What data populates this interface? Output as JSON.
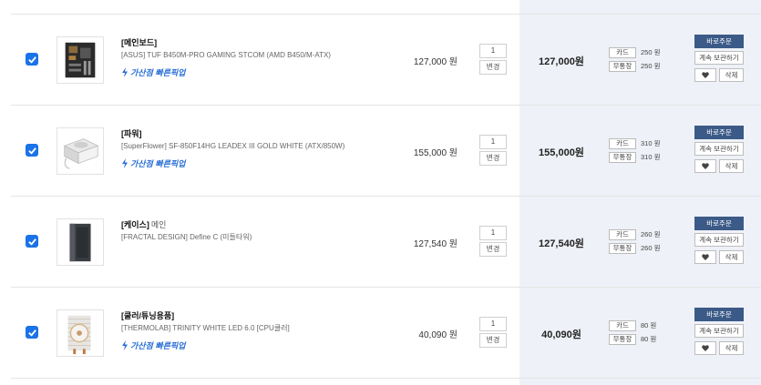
{
  "cart": {
    "items": [
      {
        "category": "[메인보드]",
        "category_sub": "",
        "name": "[ASUS] TUF B450M-PRO GAMING STCOM (AMD B450/M-ATX)",
        "pickup": "가산점 빠른픽업",
        "unit_price": "127,000 원",
        "quantity": "1",
        "change_label": "변경",
        "total": "127,000원",
        "card_label": "카드",
        "card_points": "250 원",
        "cash_label": "무통장",
        "cash_points": "250 원",
        "buy_label": "바로주문",
        "keep_label": "계속 보관하기",
        "delete_label": "삭제",
        "image": "motherboard-image"
      },
      {
        "category": "[파워]",
        "category_sub": "",
        "name": "[SuperFlower] SF-850F14HG LEADEX III GOLD WHITE (ATX/850W)",
        "pickup": "가산점 빠른픽업",
        "unit_price": "155,000 원",
        "quantity": "1",
        "change_label": "변경",
        "total": "155,000원",
        "card_label": "카드",
        "card_points": "310 원",
        "cash_label": "무통장",
        "cash_points": "310 원",
        "buy_label": "바로주문",
        "keep_label": "계속 보관하기",
        "delete_label": "삭제",
        "image": "power-supply-image"
      },
      {
        "category": "[케이스]",
        "category_sub": "메인",
        "name": "[FRACTAL DESIGN] Define C (미들타워)",
        "pickup": "",
        "unit_price": "127,540 원",
        "quantity": "1",
        "change_label": "변경",
        "total": "127,540원",
        "card_label": "카드",
        "card_points": "260 원",
        "cash_label": "무통장",
        "cash_points": "260 원",
        "buy_label": "바로주문",
        "keep_label": "계속 보관하기",
        "delete_label": "삭제",
        "image": "pc-case-image"
      },
      {
        "category": "[쿨러/튜닝용품]",
        "category_sub": "",
        "name": "[THERMOLAB] TRINITY WHITE LED 6.0 [CPU쿨러]",
        "pickup": "가산점 빠른픽업",
        "unit_price": "40,090 원",
        "quantity": "1",
        "change_label": "변경",
        "total": "40,090원",
        "card_label": "카드",
        "card_points": "80 원",
        "cash_label": "무통장",
        "cash_points": "80 원",
        "buy_label": "바로주문",
        "keep_label": "계속 보관하기",
        "delete_label": "삭제",
        "image": "cpu-cooler-image"
      }
    ]
  },
  "colors": {
    "accent_blue": "#1a73e8",
    "pickup_blue": "#2b6fd6",
    "buy_button": "#3b5a87",
    "summary_bg": "#eef1f7"
  }
}
